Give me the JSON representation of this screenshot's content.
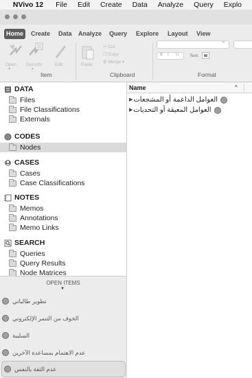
{
  "menubar": {
    "apple_glyph": "",
    "app_name": "NVivo 12",
    "items": [
      "File",
      "Edit",
      "Create",
      "Data",
      "Analyze",
      "Query",
      "Explo"
    ]
  },
  "ribbon": {
    "tabs": [
      "Home",
      "Create",
      "Data",
      "Analyze",
      "Query",
      "Explore",
      "Layout",
      "View"
    ],
    "active_tab": "Home",
    "groups": {
      "item": "Item",
      "clipboard": "Clipboard",
      "format": "Format"
    },
    "clipboard_small": [
      "Cut",
      "Copy",
      "Merge"
    ],
    "big_buttons": [
      "Open",
      "Get Info",
      "Edit",
      "Paste"
    ],
    "format_text_label": "Text:"
  },
  "nav": {
    "sections": [
      {
        "title": "DATA",
        "items": [
          "Files",
          "File Classifications",
          "Externals"
        ]
      },
      {
        "title": "CODES",
        "items": [
          "Nodes"
        ]
      },
      {
        "title": "CASES",
        "items": [
          "Cases",
          "Case Classifications"
        ]
      },
      {
        "title": "NOTES",
        "items": [
          "Memos",
          "Annotations",
          "Memo Links"
        ]
      },
      {
        "title": "SEARCH",
        "items": [
          "Queries",
          "Query Results",
          "Node Matrices"
        ]
      }
    ],
    "selected_item": "Nodes"
  },
  "open_items": {
    "header": "OPEN ITEMS",
    "items": [
      "تطوير طالباتي",
      "الخوف من التنمر الإلكتروني",
      "السلبية",
      "عدم الاهتمام بمساعدة الآخرين",
      "عدم الثقة بالنفس"
    ],
    "active_index": 4
  },
  "list": {
    "column_name": "Name",
    "sort_glyph": "^",
    "rows": [
      "العوامل الداعمة أو المشجعات",
      "العوامل المعيقة أو التحديات"
    ]
  }
}
